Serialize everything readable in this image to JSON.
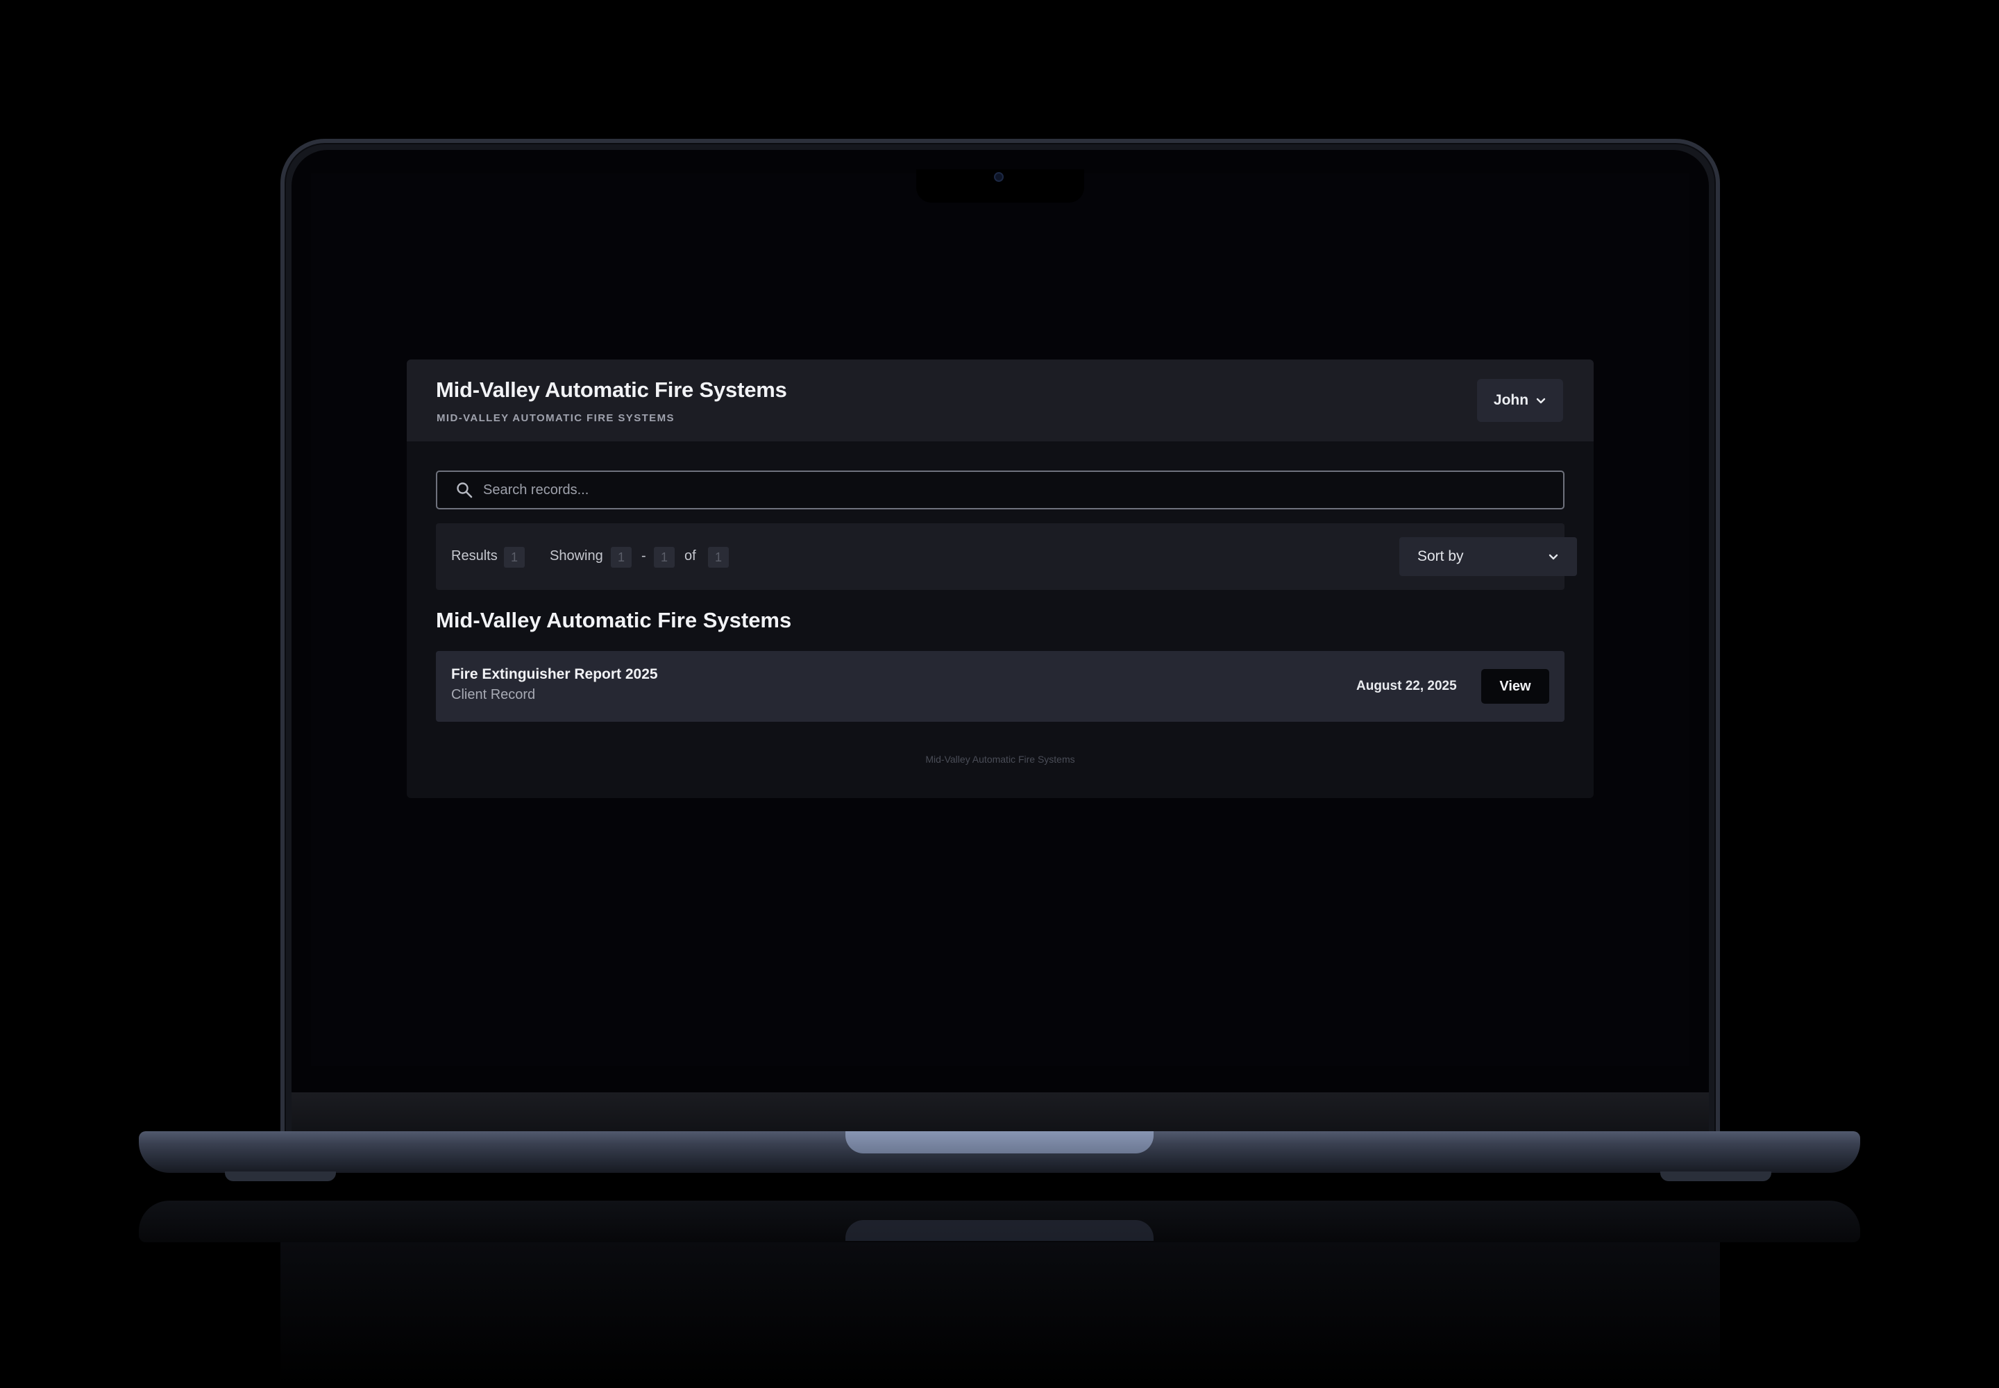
{
  "header": {
    "title": "Mid-Valley Automatic Fire Systems",
    "subtitle": "MID-VALLEY AUTOMATIC FIRE SYSTEMS",
    "user_menu_label": "John"
  },
  "search": {
    "placeholder": "Search records...",
    "value": ""
  },
  "results_bar": {
    "results_label": "Results",
    "results_count": "1",
    "showing_label": "Showing",
    "range_start": "1",
    "range_separator": "-",
    "range_end": "1",
    "of_label": "of",
    "total": "1",
    "sort_label": "Sort by"
  },
  "section": {
    "title": "Mid-Valley Automatic Fire Systems"
  },
  "records": [
    {
      "title": "Fire Extinguisher Report 2025",
      "type": "Client Record",
      "date": "August 22, 2025",
      "action_label": "View"
    }
  ],
  "footer": {
    "text": "Mid-Valley Automatic Fire Systems"
  },
  "icons": {
    "search": "search-icon",
    "user_chevron": "chevron-down-icon",
    "sort_chevron": "chevron-down-icon"
  },
  "colors": {
    "background": "#000000",
    "panel": "#0f1015",
    "header": "#1c1d24",
    "row": "#262833",
    "text": "#f2f3f6"
  }
}
